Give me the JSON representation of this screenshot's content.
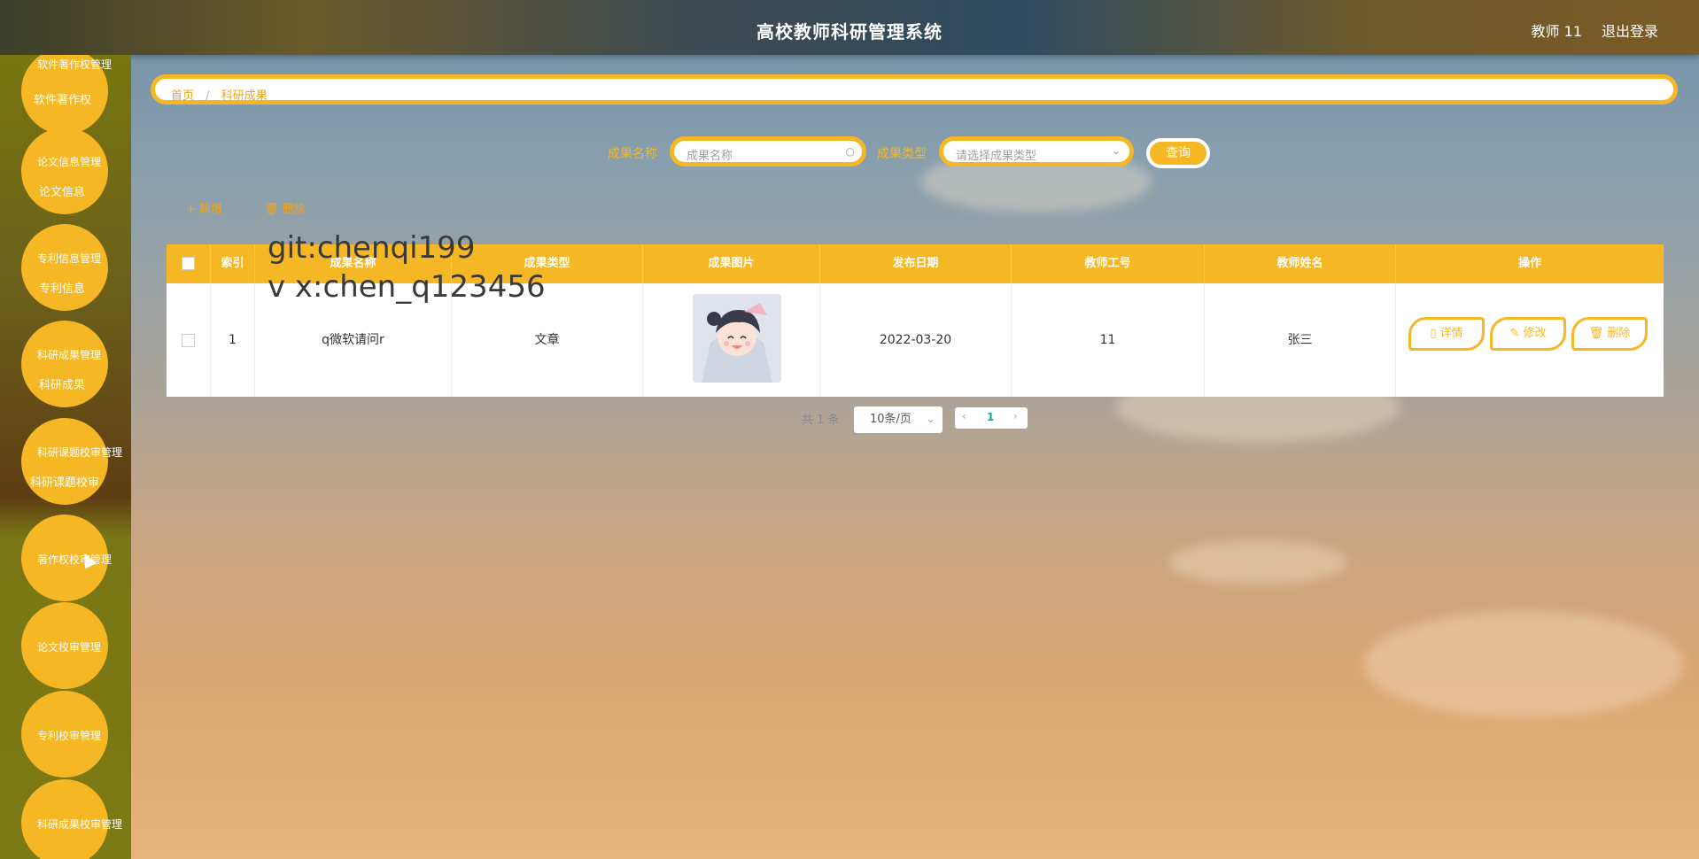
{
  "header": {
    "title": "高校教师科研管理系统",
    "user": "教师 11",
    "logout": "退出登录"
  },
  "sidebar": {
    "items": [
      {
        "main": "软件著作权管理",
        "sub": "软件著作权"
      },
      {
        "main": "论文信息管理",
        "sub": "论文信息"
      },
      {
        "main": "专利信息管理",
        "sub": "专利信息"
      },
      {
        "main": "科研成果管理",
        "sub": "科研成果"
      },
      {
        "main": "科研课题校审管理",
        "sub": "科研课题校审"
      },
      {
        "main": "著作权校审管理",
        "sub": ""
      },
      {
        "main": "论文校审管理",
        "sub": ""
      },
      {
        "main": "专利校审管理",
        "sub": ""
      },
      {
        "main": "科研成果校审管理",
        "sub": ""
      }
    ]
  },
  "breadcrumb": {
    "home": "首页",
    "separator": "/",
    "current": "科研成果"
  },
  "search": {
    "name_label": "成果名称",
    "name_placeholder": "成果名称",
    "type_label": "成果类型",
    "type_placeholder": "请选择成果类型",
    "query_button": "查询"
  },
  "toolbar": {
    "add": "+ 新增",
    "delete": "删除"
  },
  "table": {
    "headers": [
      "索引",
      "成果名称",
      "成果类型",
      "成果图片",
      "发布日期",
      "教师工号",
      "教师姓名",
      "操作"
    ],
    "rows": [
      {
        "index": "1",
        "name": "q微软请问r",
        "type": "文章",
        "image": "avatar-image",
        "date": "2022-03-20",
        "teacher_id": "11",
        "teacher_name": "张三"
      }
    ],
    "actions": {
      "detail": "详情",
      "edit": "修改",
      "delete": "删除"
    }
  },
  "pagination": {
    "total": "共 1 条",
    "page_size": "10条/页",
    "current_page": "1"
  },
  "watermark": {
    "line1": "git:chenqi199",
    "line2": "v x:chen_q123456"
  },
  "colors": {
    "accent": "#f6b725"
  }
}
